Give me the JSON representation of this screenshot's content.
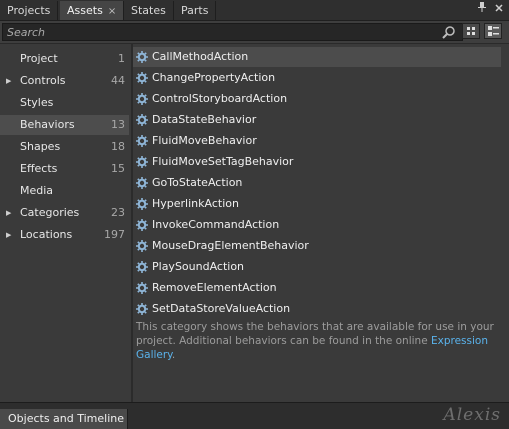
{
  "tabs": [
    {
      "label": "Projects",
      "active": false
    },
    {
      "label": "Assets",
      "active": true,
      "close": "×"
    },
    {
      "label": "States",
      "active": false
    },
    {
      "label": "Parts",
      "active": false
    }
  ],
  "header_icons": {
    "pin": "pin-icon",
    "close": "close-icon"
  },
  "search": {
    "placeholder": "Search",
    "value": ""
  },
  "view_buttons": [
    "grid-view-icon",
    "list-view-icon"
  ],
  "categories": [
    {
      "label": "Project",
      "count": "1",
      "expandable": false,
      "selected": false
    },
    {
      "label": "Controls",
      "count": "44",
      "expandable": true,
      "selected": false
    },
    {
      "label": "Styles",
      "count": "",
      "expandable": false,
      "selected": false
    },
    {
      "label": "Behaviors",
      "count": "13",
      "expandable": false,
      "selected": true
    },
    {
      "label": "Shapes",
      "count": "18",
      "expandable": false,
      "selected": false
    },
    {
      "label": "Effects",
      "count": "15",
      "expandable": false,
      "selected": false
    },
    {
      "label": "Media",
      "count": "",
      "expandable": false,
      "selected": false
    },
    {
      "label": "Categories",
      "count": "23",
      "expandable": true,
      "selected": false
    },
    {
      "label": "Locations",
      "count": "197",
      "expandable": true,
      "selected": false
    }
  ],
  "assets": [
    {
      "name": "CallMethodAction",
      "selected": true
    },
    {
      "name": "ChangePropertyAction"
    },
    {
      "name": "ControlStoryboardAction"
    },
    {
      "name": "DataStateBehavior"
    },
    {
      "name": "FluidMoveBehavior"
    },
    {
      "name": "FluidMoveSetTagBehavior"
    },
    {
      "name": "GoToStateAction"
    },
    {
      "name": "HyperlinkAction"
    },
    {
      "name": "InvokeCommandAction"
    },
    {
      "name": "MouseDragElementBehavior"
    },
    {
      "name": "PlaySoundAction"
    },
    {
      "name": "RemoveElementAction"
    },
    {
      "name": "SetDataStoreValueAction"
    }
  ],
  "description": {
    "text": "This category shows the behaviors that are available for use in your project. Additional behaviors can be found in the online ",
    "link": "Expression Gallery",
    "end": "."
  },
  "bottom_tab": "Objects and Timeline",
  "watermark": "Alexis",
  "colors": {
    "link": "#5ab3ec",
    "background": "#3a3a3a",
    "selection": "#4c4c4c"
  }
}
